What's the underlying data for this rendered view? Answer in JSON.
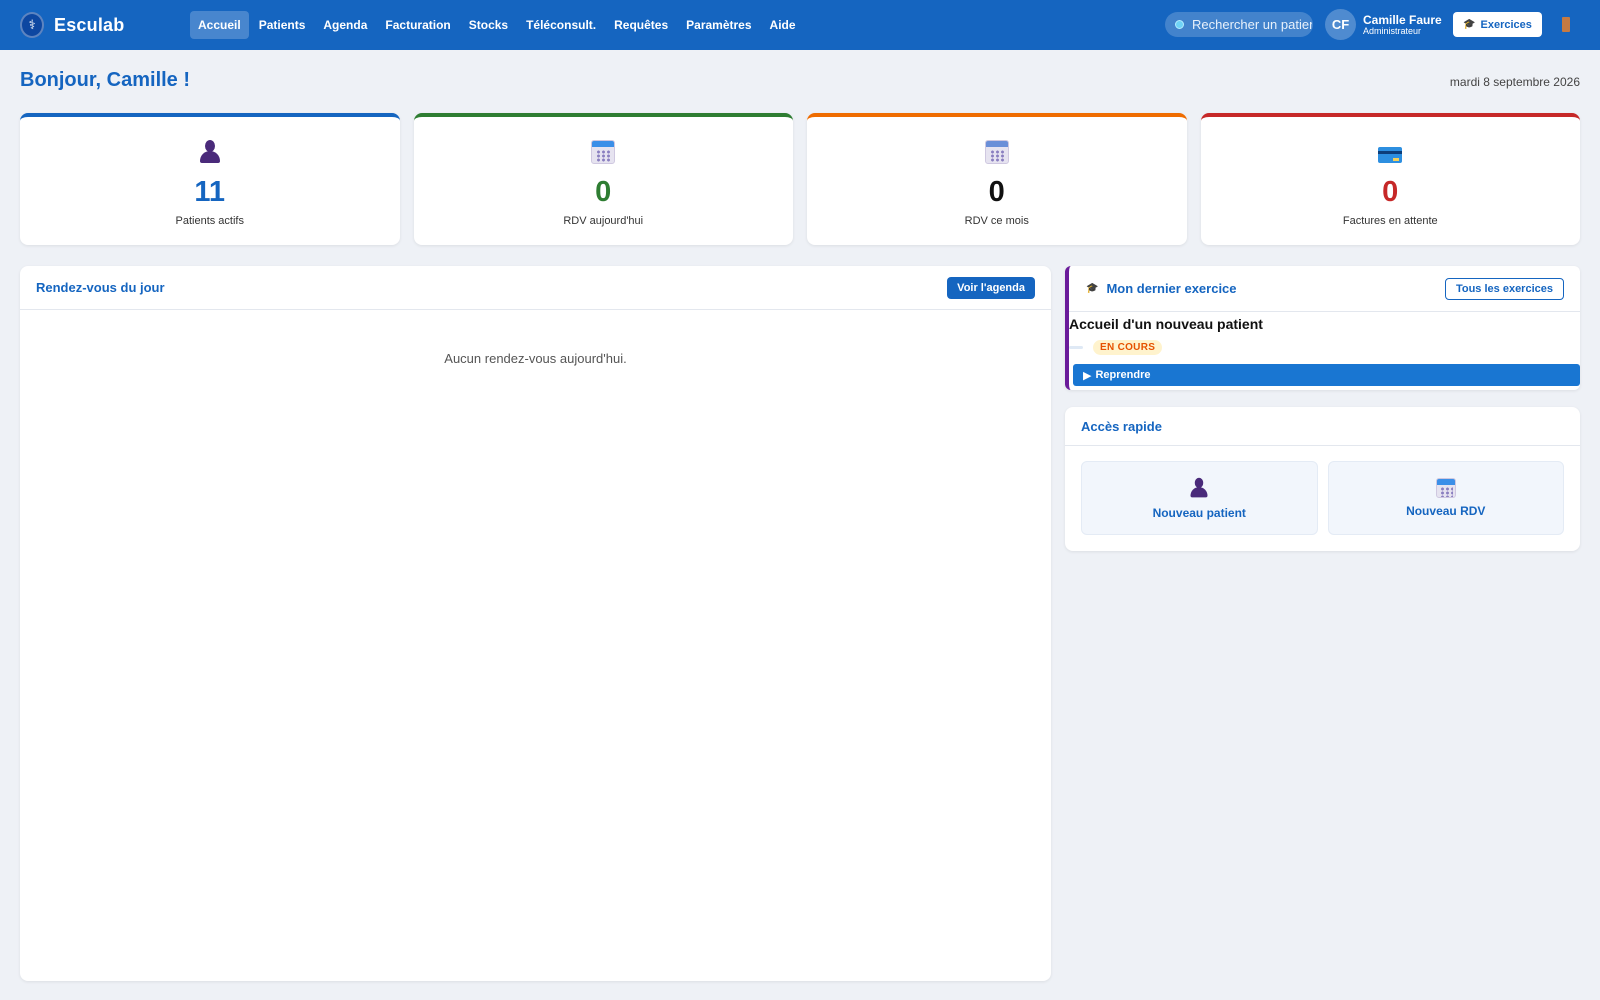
{
  "app": {
    "name": "Esculab",
    "logo_glyph": "⚕"
  },
  "nav": {
    "items": [
      {
        "label": "Accueil",
        "active": true
      },
      {
        "label": "Patients"
      },
      {
        "label": "Agenda"
      },
      {
        "label": "Facturation"
      },
      {
        "label": "Stocks"
      },
      {
        "label": "Téléconsult."
      },
      {
        "label": "Requêtes"
      },
      {
        "label": "Paramètres"
      },
      {
        "label": "Aide"
      }
    ]
  },
  "search": {
    "placeholder": "Rechercher un patient...",
    "value": ""
  },
  "user": {
    "initials": "CF",
    "name": "Camille Faure",
    "role": "Administrateur"
  },
  "exercises_button": {
    "label": "Exercices",
    "icon": "graduation-cap-icon"
  },
  "greeting": "Bonjour, Camille !",
  "date": "mardi 8 septembre 2026",
  "stats": [
    {
      "value": "11",
      "label": "Patients actifs",
      "color": "#1565c0",
      "icon": "person-icon"
    },
    {
      "value": "0",
      "label": "RDV aujourd'hui",
      "color": "#2e7d32",
      "icon": "calendar-icon"
    },
    {
      "value": "0",
      "label": "RDV ce mois",
      "color": "#111111",
      "icon": "calendar-icon",
      "accent": "#ef6c00"
    },
    {
      "value": "0",
      "label": "Factures en attente",
      "color": "#c62828",
      "icon": "credit-card-icon"
    }
  ],
  "rdv_panel": {
    "title": "Rendez-vous du jour",
    "button": "Voir l'agenda",
    "empty_text": "Aucun rendez-vous aujourd'hui."
  },
  "exercise_panel": {
    "title": "Mon dernier exercice",
    "button": "Tous les exercices",
    "exercise_name": "Accueil d'un nouveau patient",
    "status": "EN COURS",
    "resume_label": "Reprendre"
  },
  "quick_panel": {
    "title": "Accès rapide",
    "items": [
      {
        "label": "Nouveau patient",
        "icon": "person-icon"
      },
      {
        "label": "Nouveau RDV",
        "icon": "calendar-icon"
      }
    ]
  },
  "colors": {
    "primary": "#1565c0",
    "exercise_accent": "#6a1b9a"
  }
}
